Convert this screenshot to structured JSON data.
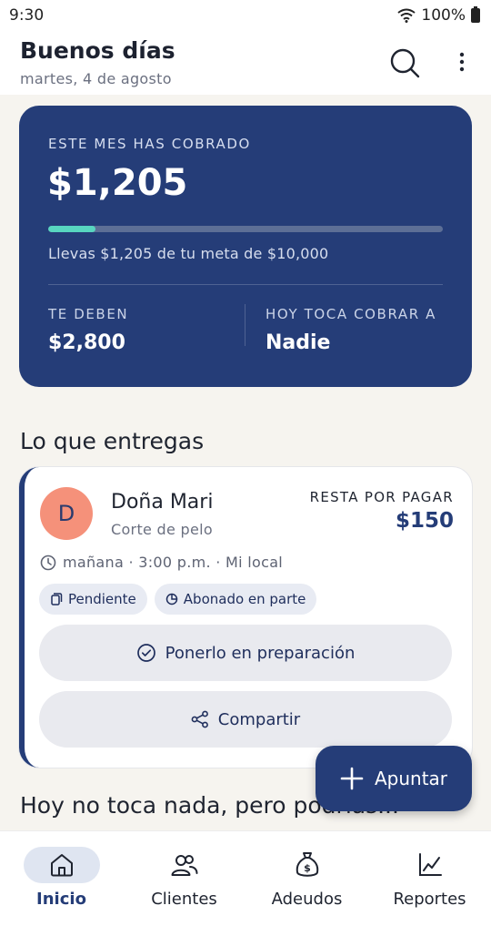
{
  "status_bar": {
    "time": "9:30",
    "battery": "100%"
  },
  "header": {
    "title": "Buenos días",
    "date": "martes, 4 de agosto"
  },
  "summary": {
    "collected_label": "ESTE MES HAS COBRADO",
    "collected_amount": "$1,205",
    "goal_progress": 0.12,
    "goal_text": "Llevas $1,205 de tu meta de $10,000",
    "owed_label": "TE DEBEN",
    "owed_value": "$2,800",
    "today_label": "HOY TOCA COBRAR A",
    "today_value": "Nadie"
  },
  "deliveries": {
    "title": "Lo que entregas",
    "card": {
      "avatar_letter": "D",
      "client_name": "Doña Mari",
      "service": "Corte de pelo",
      "rest_label": "RESTA POR PAGAR",
      "rest_value": "$150",
      "schedule": "mañana · 3:00 p.m. · Mi local",
      "chips": [
        "Pendiente",
        "Abonado en parte"
      ],
      "prepare_label": "Ponerlo en preparación",
      "share_label": "Compartir"
    }
  },
  "suggestion_title": "Hoy no toca nada, pero podrías...",
  "fab_label": "Apuntar",
  "nav": {
    "items": [
      {
        "label": "Inicio",
        "icon": "home-icon"
      },
      {
        "label": "Clientes",
        "icon": "users-icon"
      },
      {
        "label": "Adeudos",
        "icon": "money-bag-icon"
      },
      {
        "label": "Reportes",
        "icon": "chart-icon"
      }
    ]
  },
  "colors": {
    "primary": "#253d78",
    "accent": "#58d6c0",
    "avatar": "#f5917a",
    "background": "#f6f4ef"
  }
}
